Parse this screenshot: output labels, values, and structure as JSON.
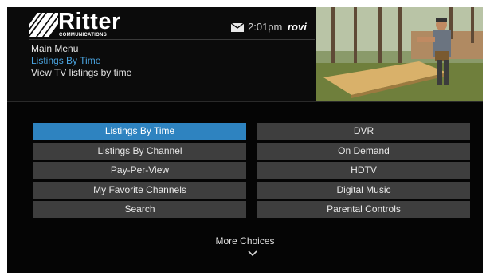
{
  "header": {
    "logo_text": "Ritter",
    "logo_sub": "COMMUNICATIONS",
    "breadcrumb_root": "Main Menu",
    "current_menu": "Listings By Time",
    "description": "View TV listings by time",
    "clock": "2:01pm",
    "provider": "rovi",
    "mail_icon": "envelope-icon"
  },
  "preview": {
    "content": "live-tv-preview-video"
  },
  "menu": {
    "left": [
      {
        "label": "Listings By Time",
        "selected": true
      },
      {
        "label": "Listings By Channel",
        "selected": false
      },
      {
        "label": "Pay-Per-View",
        "selected": false
      },
      {
        "label": "My Favorite Channels",
        "selected": false
      },
      {
        "label": "Search",
        "selected": false
      }
    ],
    "right": [
      {
        "label": "DVR",
        "selected": false
      },
      {
        "label": "On Demand",
        "selected": false
      },
      {
        "label": "HDTV",
        "selected": false
      },
      {
        "label": "Digital Music",
        "selected": false
      },
      {
        "label": "Parental Controls",
        "selected": false
      }
    ],
    "more_label": "More Choices",
    "more_icon": "chevron-down-icon"
  },
  "colors": {
    "selected": "#2e83c0",
    "button": "#3e3e3e",
    "current_text": "#4aa3df",
    "background": "#050505"
  }
}
